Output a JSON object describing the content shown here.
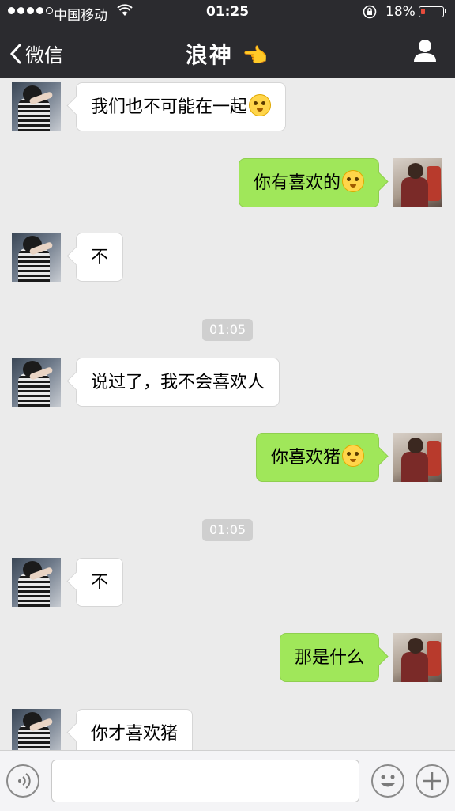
{
  "status_bar": {
    "carrier": "中国移动",
    "time": "01:25",
    "battery": "18%",
    "battery_level": 0.18
  },
  "nav": {
    "back_label": "微信",
    "title": "浪神",
    "title_icon": "👈"
  },
  "messages": [
    {
      "side": "left",
      "text": "我们也不可能在一起",
      "emoji": "smile-emoji"
    },
    {
      "side": "right",
      "text": "你有喜欢的",
      "emoji": "surprised-emoji"
    },
    {
      "side": "left",
      "text": "不"
    },
    {
      "timestamp": "01:05"
    },
    {
      "side": "left",
      "text": "说过了，我不会喜欢人"
    },
    {
      "side": "right",
      "text": "你喜欢猪",
      "emoji": "shocked-emoji"
    },
    {
      "timestamp": "01:05"
    },
    {
      "side": "left",
      "text": "不"
    },
    {
      "side": "right",
      "text": "那是什么"
    },
    {
      "side": "left",
      "text": "你才喜欢猪"
    }
  ],
  "colors": {
    "nav_bg": "#2b2b2f",
    "chat_bg": "#ebebeb",
    "sent_bubble": "#a0e75a",
    "received_bubble": "#ffffff"
  }
}
